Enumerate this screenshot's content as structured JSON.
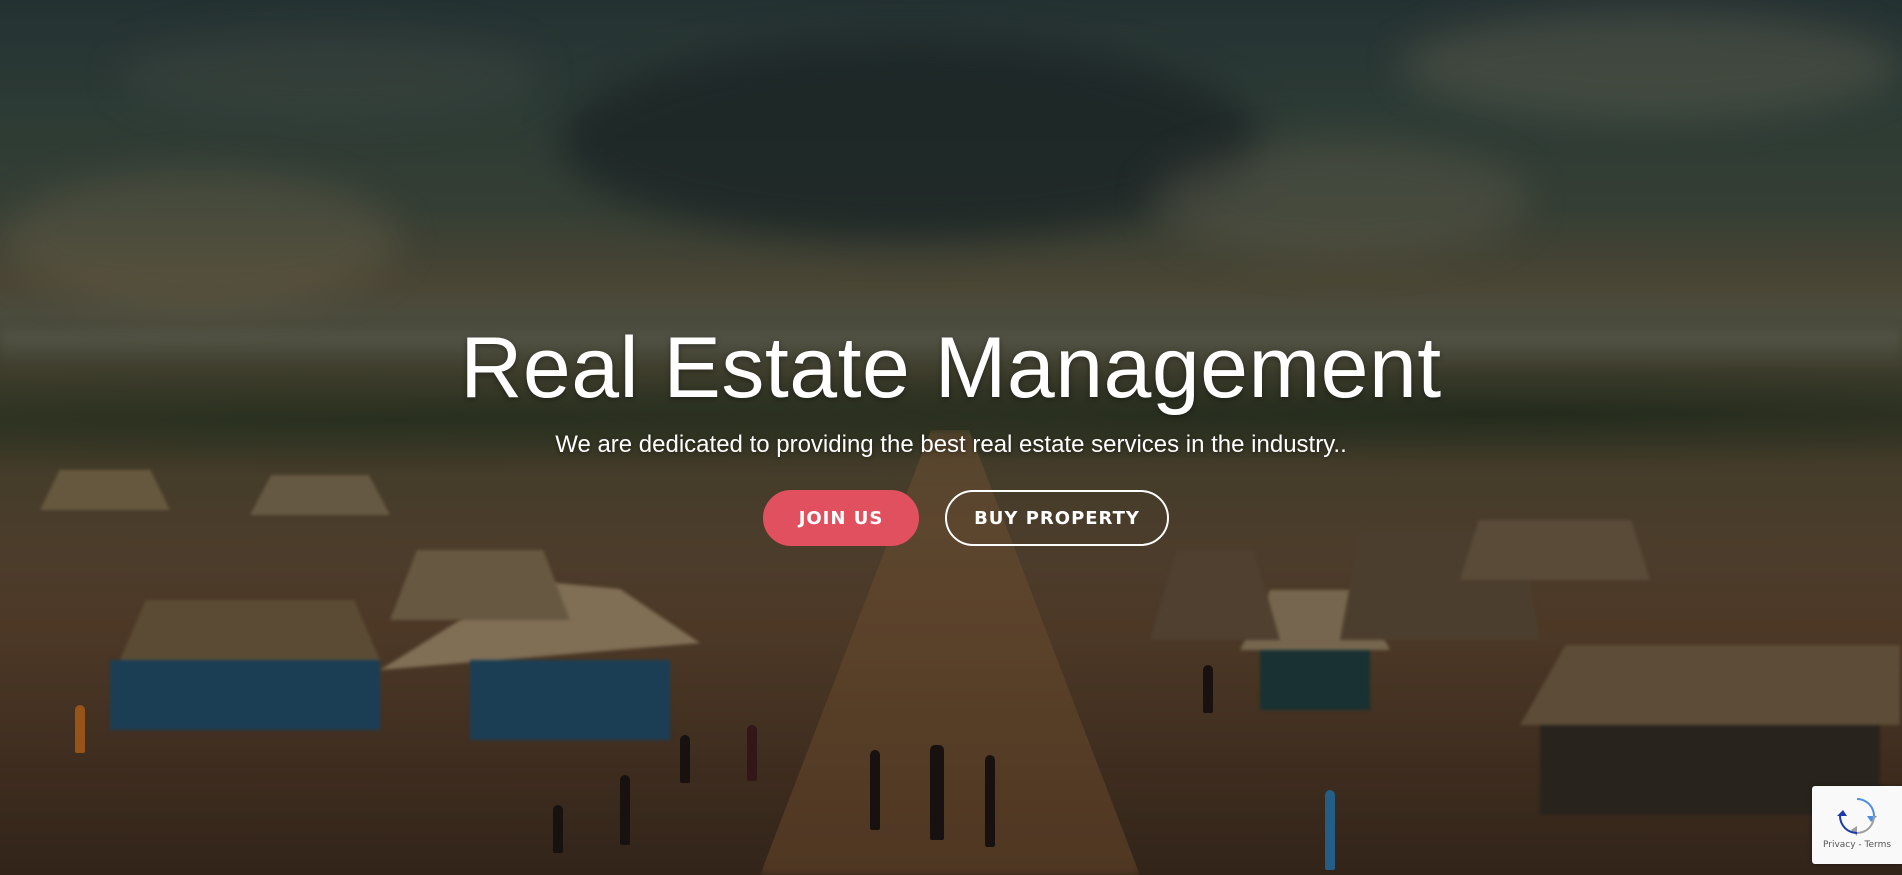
{
  "hero": {
    "title": "Real Estate Management",
    "subtitle": "We are dedicated to providing the best real estate services in the industry..",
    "primary_button": "JOIN US",
    "secondary_button": "BUY PROPERTY"
  },
  "recaptcha": {
    "links": "Privacy - Terms"
  },
  "colors": {
    "primary_button": "#e0505e",
    "text": "#ffffff"
  },
  "icons": {
    "recaptcha": "recaptcha-icon"
  }
}
